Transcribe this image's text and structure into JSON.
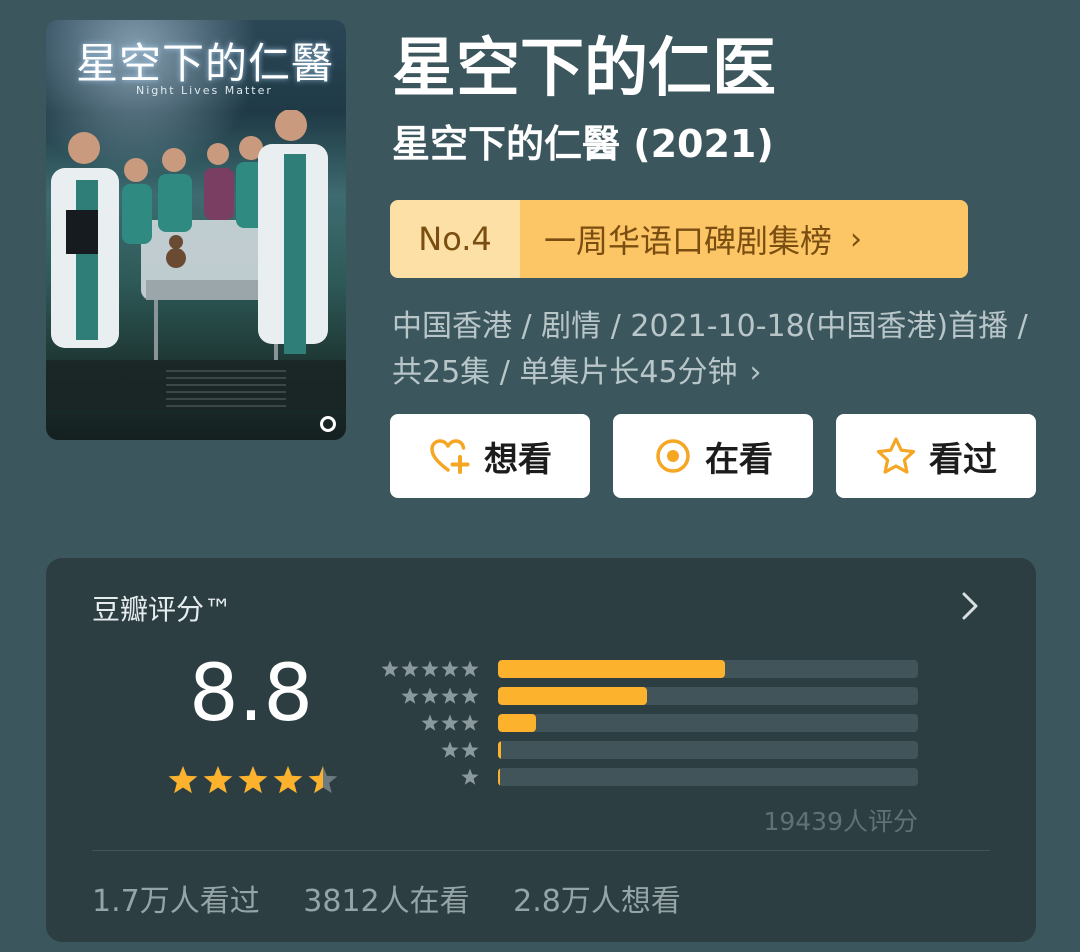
{
  "poster": {
    "title": "星空下的仁醫",
    "subtitle": "Night Lives Matter"
  },
  "title": {
    "main": "星空下的仁医",
    "original": "星空下的仁醫 (2021)"
  },
  "rank": {
    "number": "No.4",
    "list": "一周华语口碑剧集榜",
    "chevron": "›"
  },
  "info": {
    "text": "中国香港 / 剧情 / 2021-10-18(中国香港)首播 / 共25集 / 单集片长45分钟",
    "chevron": "›"
  },
  "actions": {
    "want": "想看",
    "watching": "在看",
    "watched": "看过"
  },
  "rating": {
    "title": "豆瓣评分™",
    "score": "8.8",
    "stars": 4.5,
    "count": "19439人评分",
    "distribution": [
      {
        "stars": 5,
        "fraction": 0.54
      },
      {
        "stars": 4,
        "fraction": 0.355
      },
      {
        "stars": 3,
        "fraction": 0.09
      },
      {
        "stars": 2,
        "fraction": 0.006
      },
      {
        "stars": 1,
        "fraction": 0.005
      }
    ]
  },
  "stats": {
    "watched": "1.7万人看过",
    "watching": "3812人在看",
    "want": "2.8万人想看"
  },
  "colors": {
    "background": "#3b565c",
    "card": "#2c3e42",
    "accent": "#fcb22c",
    "rank_light": "#fde0a6",
    "rank_dark": "#fcc566",
    "rank_text": "#7a4d10"
  }
}
